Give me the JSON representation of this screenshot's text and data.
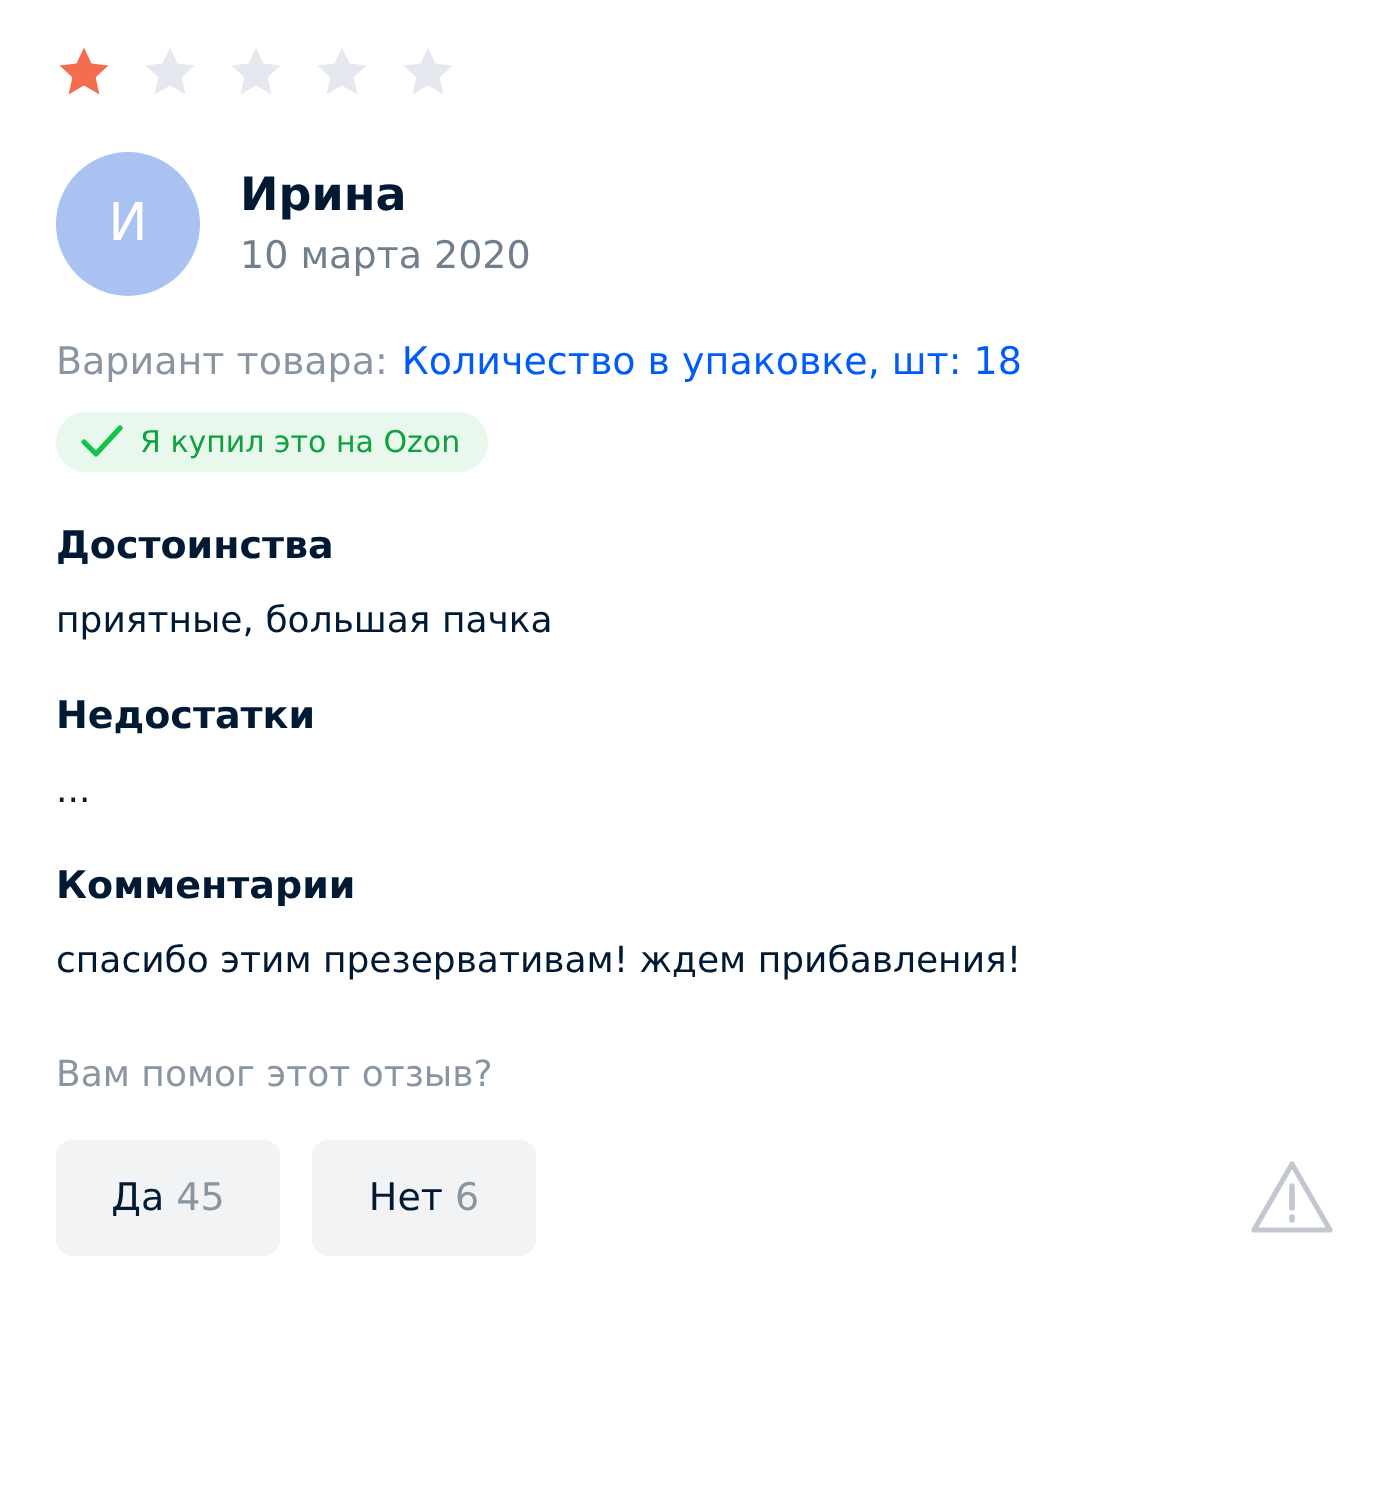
{
  "review": {
    "stars": 1,
    "author": {
      "initial": "И",
      "name": "Ирина",
      "date": "10 марта 2020"
    },
    "variant": {
      "label": "Вариант товара:",
      "value": "Количество в упаковке, шт: 18"
    },
    "badge": "Я купил это на Ozon",
    "sections": [
      {
        "title": "Достоинства",
        "text": "приятные, большая пачка"
      },
      {
        "title": "Недостатки",
        "text": "..."
      },
      {
        "title": "Комментарии",
        "text": "спасибо этим презервативам! ждем прибавления!"
      }
    ],
    "helpful": {
      "question": "Вам помог этот отзыв?",
      "buttons": [
        {
          "label": "Да",
          "count": "45"
        },
        {
          "label": "Нет",
          "count": "6"
        }
      ]
    }
  }
}
